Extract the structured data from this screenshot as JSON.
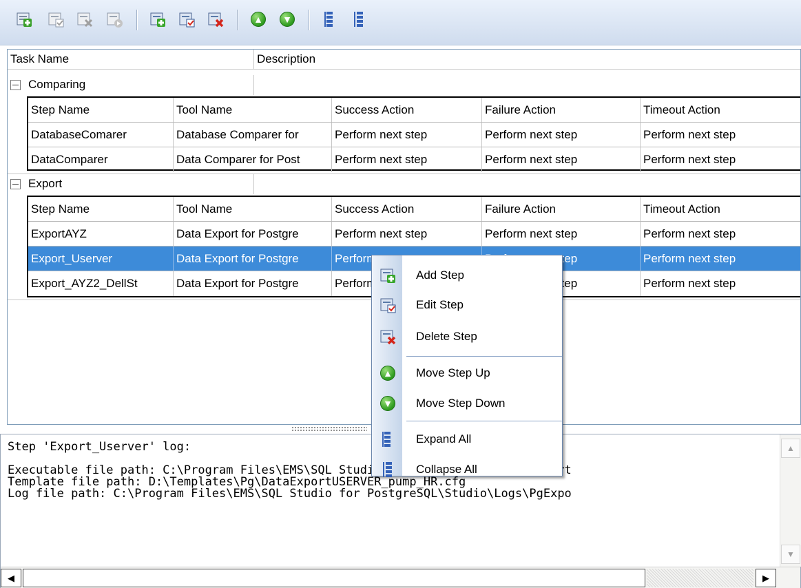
{
  "toolbar": {
    "buttons": [
      {
        "name": "add-task"
      },
      {
        "name": "edit-task"
      },
      {
        "name": "delete-task"
      },
      {
        "name": "run-task"
      },
      {
        "name": "add-step"
      },
      {
        "name": "edit-step"
      },
      {
        "name": "delete-step"
      },
      {
        "name": "move-up"
      },
      {
        "name": "move-down"
      },
      {
        "name": "expand-all"
      },
      {
        "name": "collapse-all"
      }
    ]
  },
  "grid": {
    "columns": [
      "Task Name",
      "Description"
    ],
    "groups": [
      {
        "name": "Comparing",
        "detail_columns": [
          "Step Name",
          "Tool Name",
          "Success Action",
          "Failure Action",
          "Timeout Action"
        ],
        "rows": [
          [
            "DatabaseComarer",
            "Database Comparer for",
            "Perform next step",
            "Perform next step",
            "Perform next step"
          ],
          [
            "DataComparer",
            "Data Comparer for Post",
            "Perform next step",
            "Perform next step",
            "Perform next step"
          ]
        ]
      },
      {
        "name": "Export",
        "detail_columns": [
          "Step Name",
          "Tool Name",
          "Success Action",
          "Failure Action",
          "Timeout Action"
        ],
        "rows": [
          [
            "ExportAYZ",
            "Data Export for Postgre",
            "Perform next step",
            "Perform next step",
            "Perform next step"
          ],
          [
            "Export_Userver",
            "Data Export for Postgre",
            "Perform next step",
            "Perform next step",
            "Perform next step"
          ],
          [
            "Export_AYZ2_DellSt",
            "Data Export for Postgre",
            "Perform next step",
            "Perform next step",
            "Perform next step"
          ]
        ]
      }
    ]
  },
  "log": {
    "lines": [
      "Step 'Export_Userver' log:",
      "",
      "Executable file path: C:\\Program Files\\EMS\\SQL Studio for PostgreSQL\\Data Export",
      "Template file path: D:\\Templates\\Pg\\DataExportUSERVER_pump_HR.cfg",
      "Log file path: C:\\Program Files\\EMS\\SQL Studio for PostgreSQL\\Studio\\Logs\\PgExpo"
    ]
  },
  "context_menu": {
    "items": [
      {
        "label": "Add Step",
        "icon": "add-step-icon"
      },
      {
        "label": "Edit Step",
        "icon": "edit-step-icon"
      },
      {
        "label": "Delete Step",
        "icon": "delete-step-icon"
      },
      {
        "label": "Move Step Up",
        "icon": "arrow-up-icon"
      },
      {
        "label": "Move Step Down",
        "icon": "arrow-down-icon"
      },
      {
        "label": "Expand All",
        "icon": "expand-all-icon"
      },
      {
        "label": "Collapse All",
        "icon": "collapse-all-icon"
      }
    ]
  },
  "colors": {
    "selection": "#3d8bd9",
    "toolbar_bg": "#cfdcee",
    "menu_border": "#6c87ad"
  }
}
